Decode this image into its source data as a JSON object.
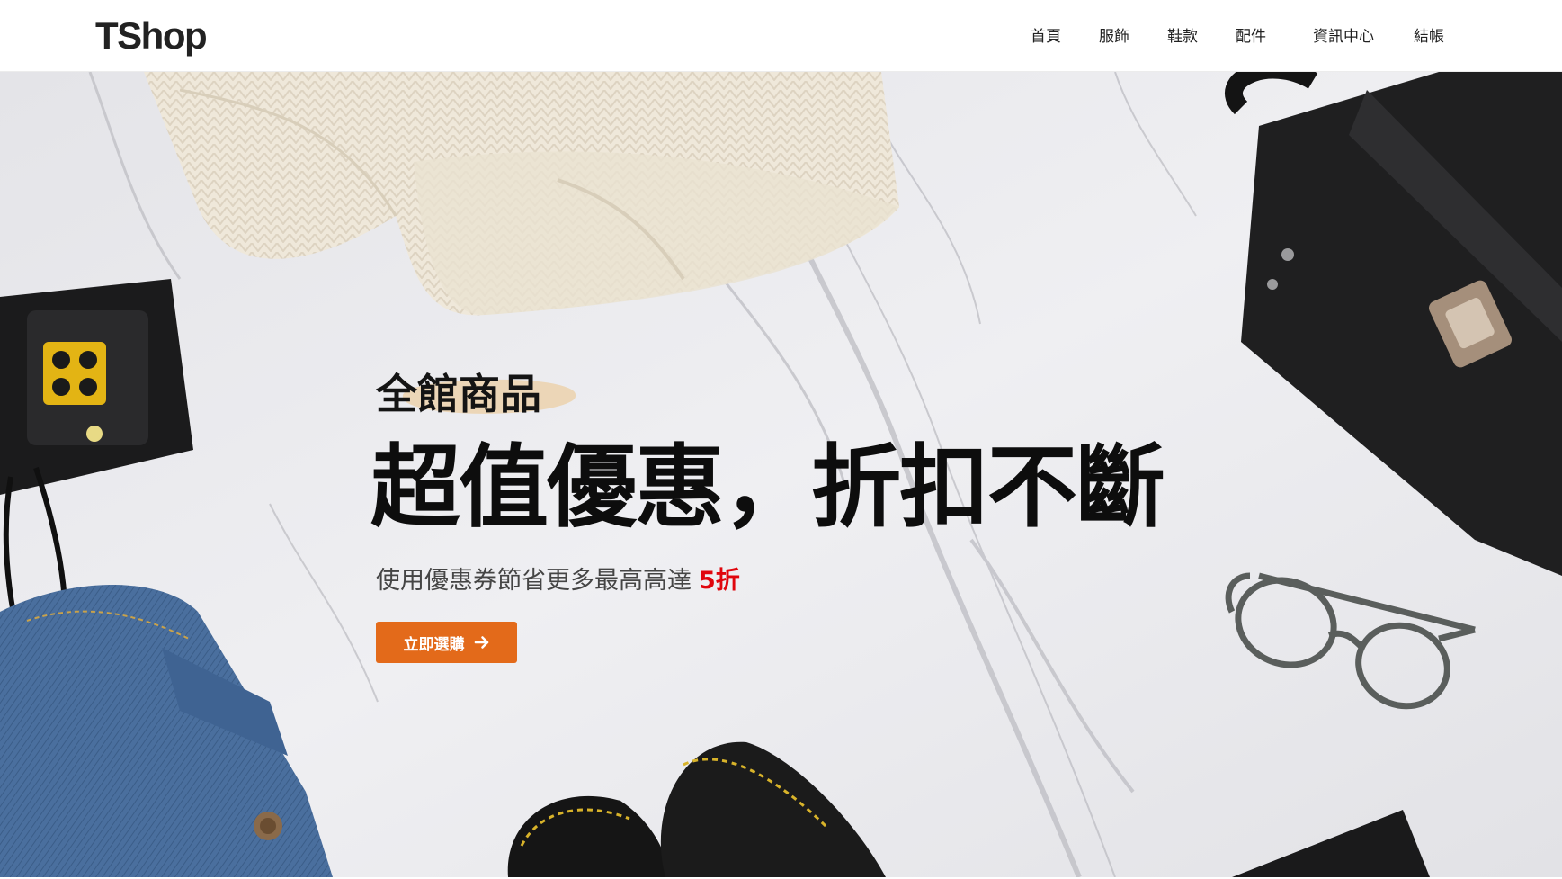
{
  "header": {
    "brand": "TShop",
    "nav": [
      {
        "label": "首頁"
      },
      {
        "label": "服飾"
      },
      {
        "label": "鞋款"
      },
      {
        "label": "配件"
      },
      {
        "label": "資訊中心"
      },
      {
        "label": "結帳"
      }
    ]
  },
  "hero": {
    "eyebrow": "全館商品",
    "headline": "超值優惠，折扣不斷",
    "subline_prefix": "使用優惠券節省更多最高高達",
    "subline_highlight": "5折",
    "cta_label": "立即選購",
    "cta_icon": "arrow-right-icon",
    "background_items": [
      "knit-sweater",
      "camera",
      "denim-jeans",
      "leather-handbag",
      "eyeglasses",
      "leather-shoes",
      "notebook"
    ]
  },
  "colors": {
    "accent": "#e36a1a",
    "highlight": "#e0060d",
    "text_dark": "#0d0d0d",
    "marble": "#e9e9ec"
  }
}
